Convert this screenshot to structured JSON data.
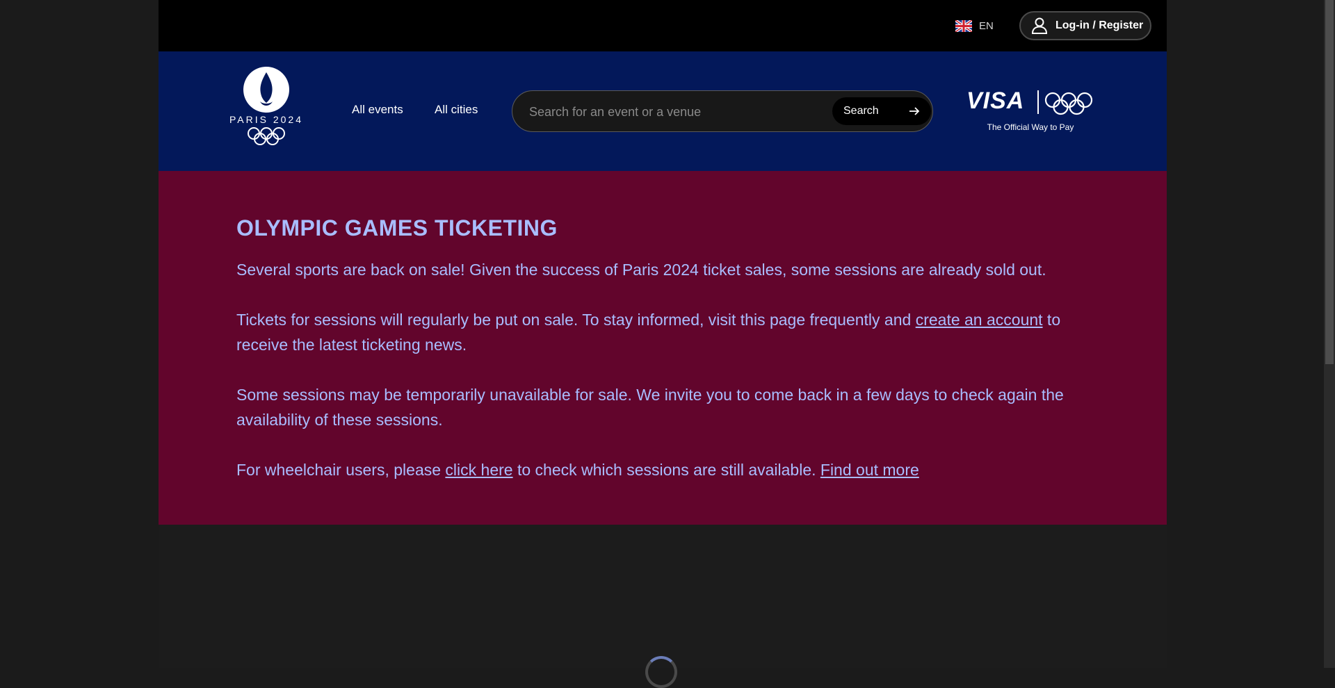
{
  "topbar": {
    "language": "EN",
    "login_label": "Log-in / Register"
  },
  "navbar": {
    "logo_text": "PARIS 2024",
    "links": [
      "All events",
      "All cities"
    ],
    "search_placeholder": "Search for an event or a venue",
    "search_button": "Search",
    "sponsor_name": "VISA",
    "sponsor_tagline": "The Official Way to Pay"
  },
  "banner": {
    "title": "OLYMPIC GAMES TICKETING",
    "p1": "Several sports are back on sale! Given the success of Paris 2024 ticket sales, some sessions are already sold out.",
    "p2_before": "Tickets for sessions will regularly be put on sale. To stay informed, visit this page frequently and ",
    "p2_link": "create an account",
    "p2_after": " to receive the latest ticketing news.",
    "p3": "Some sessions may be temporarily unavailable for sale. We invite you to come back in a few days to check again the availability of these sessions.",
    "p4_before": "For wheelchair users, please ",
    "p4_link1": "click here",
    "p4_mid": " to check which sessions are still available. ",
    "p4_link2": "Find out more"
  },
  "colors": {
    "topbar_bg": "#000000",
    "navbar_bg": "#03185a",
    "banner_bg": "#62052c",
    "banner_text": "#a9bdff",
    "page_bg": "#1b1b1b"
  },
  "icons": [
    "uk-flag-icon",
    "user-icon",
    "arrow-right-icon",
    "olympic-rings-icon",
    "flame-logo-icon",
    "loading-spinner"
  ]
}
